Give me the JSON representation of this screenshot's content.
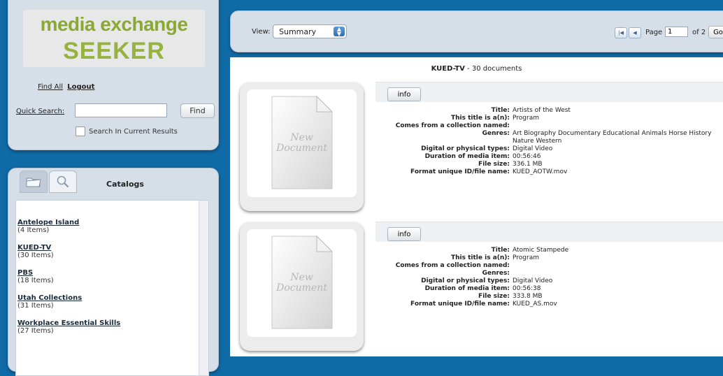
{
  "logo": {
    "line1": "media exchange",
    "line2": "SEEKER"
  },
  "nav": {
    "find_all": "Find All",
    "logout": "Logout"
  },
  "search": {
    "label": "Quick Search:",
    "value": "",
    "find_button": "Find",
    "checkbox_label": "Search In Current Results",
    "checkbox_checked": false
  },
  "catalogs": {
    "title": "Catalogs",
    "items": [
      {
        "name": "Antelope Island",
        "count": "(4 Items)"
      },
      {
        "name": "KUED-TV",
        "count": "(30 Items)"
      },
      {
        "name": "PBS",
        "count": "(18 Items)"
      },
      {
        "name": "Utah Collections",
        "count": "(31 Items)"
      },
      {
        "name": "Workplace Essential Skills",
        "count": "(27 Items)"
      }
    ]
  },
  "toolbar": {
    "view_label": "View:",
    "view_value": "Summary",
    "page_label": "Page",
    "page_value": "1",
    "page_of": "of 2",
    "go_button": "Go"
  },
  "results": {
    "collection": "KUED-TV",
    "count_text": " - 30 documents",
    "thumbnail_text": [
      "New",
      "Document"
    ],
    "info_button": "info",
    "field_labels": {
      "title": "Title:",
      "type": "This title is a(n):",
      "collection": "Comes from a collection named:",
      "genres": "Genres:",
      "media_types": "Digital or physical types:",
      "duration": "Duration of media item:",
      "file_size": "File size:",
      "file_name": "Format unique ID/file name:"
    },
    "records": [
      {
        "title": "Artists of the West",
        "type": "Program",
        "collection": "",
        "genres": "Art Biography Documentary Educational Animals Horse History Nature Western",
        "media_types": "Digital Video",
        "duration": "00:56:46",
        "file_size": "336.1 MB",
        "file_name": "KUED_AOTW.mov"
      },
      {
        "title": "Atomic Stampede",
        "type": "Program",
        "collection": "",
        "genres": "",
        "media_types": "Digital Video",
        "duration": "00:56:38",
        "file_size": "333.8 MB",
        "file_name": "KUED_AS.mov"
      }
    ]
  }
}
